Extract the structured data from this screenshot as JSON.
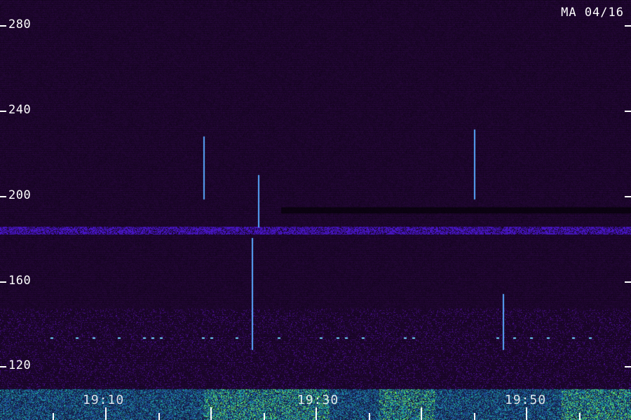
{
  "header": {
    "station_date": "MA 04/16"
  },
  "y_axis": {
    "labels": [
      "280",
      "240",
      "200",
      "160",
      "120"
    ]
  },
  "x_axis": {
    "labels": [
      "19:10",
      "19:30",
      "19:50"
    ]
  },
  "colors": {
    "background": "#2a0a3d",
    "signal": "#5a2bd6",
    "spike": "#58a8ff",
    "strong": "#7cff3a"
  }
}
